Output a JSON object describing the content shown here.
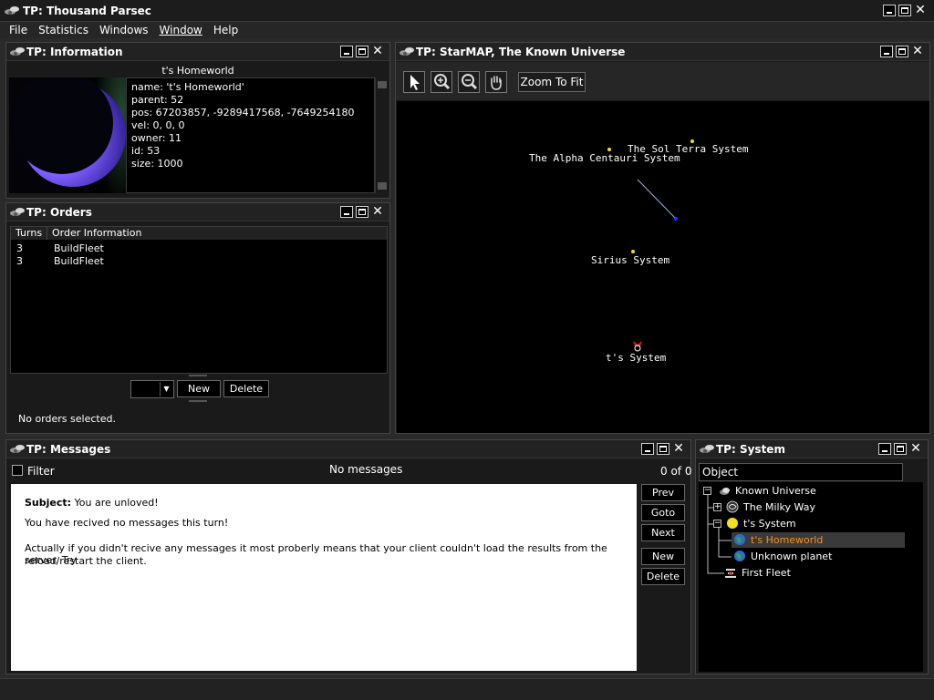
{
  "app": {
    "title": "TP: Thousand Parsec"
  },
  "menu": {
    "items": [
      "File",
      "Statistics",
      "Windows",
      "Window",
      "Help"
    ]
  },
  "info": {
    "title": "TP: Information",
    "heading": "t's Homeworld",
    "lines": [
      "name: 't's Homeworld'",
      "parent: 52",
      "pos: 67203857, -9289417568, -7649254180",
      "vel: 0, 0, 0",
      "owner: 11",
      "id: 53",
      "size: 1000"
    ]
  },
  "orders": {
    "title": "TP: Orders",
    "columns": [
      "Turns",
      "Order Information"
    ],
    "rows": [
      {
        "turns": "3",
        "info": "BuildFleet"
      },
      {
        "turns": "3",
        "info": "BuildFleet"
      }
    ],
    "new_label": "New",
    "delete_label": "Delete",
    "status": "No orders selected."
  },
  "starmap": {
    "title": "TP: StarMAP, The Known Universe",
    "zoom_fit_label": "Zoom To Fit",
    "systems": [
      {
        "name": "The Sol Terra System"
      },
      {
        "name": "The Alpha Centauri System"
      },
      {
        "name": "Sirius System"
      },
      {
        "name": "t's System"
      }
    ]
  },
  "messages": {
    "title": "TP: Messages",
    "filter_label": "Filter",
    "header": "No messages",
    "count": "0 of 0",
    "subject_label": "Subject:",
    "subject": "You are unloved!",
    "body1": "You have recived no messages this turn!",
    "body2a": "Actually if you didn't recive any messages it most proberly means that your client couldn't load the results from the server. Try",
    "body2b": "reload/restart the client.",
    "buttons": {
      "prev": "Prev",
      "goto": "Goto",
      "next": "Next",
      "new": "New",
      "delete": "Delete"
    }
  },
  "system": {
    "title": "TP: System",
    "search_placeholder": "Object",
    "tree": {
      "root": "Known Universe",
      "milky_way": "The Milky Way",
      "ts_system": "t's System",
      "homeworld": "t's Homeworld",
      "unknown_planet": "Unknown planet",
      "first_fleet": "First Fleet"
    }
  },
  "colors": {
    "selected_text": "#ff8c1a",
    "star": "#f0e020",
    "fleet_line": "#8fb3d9"
  }
}
